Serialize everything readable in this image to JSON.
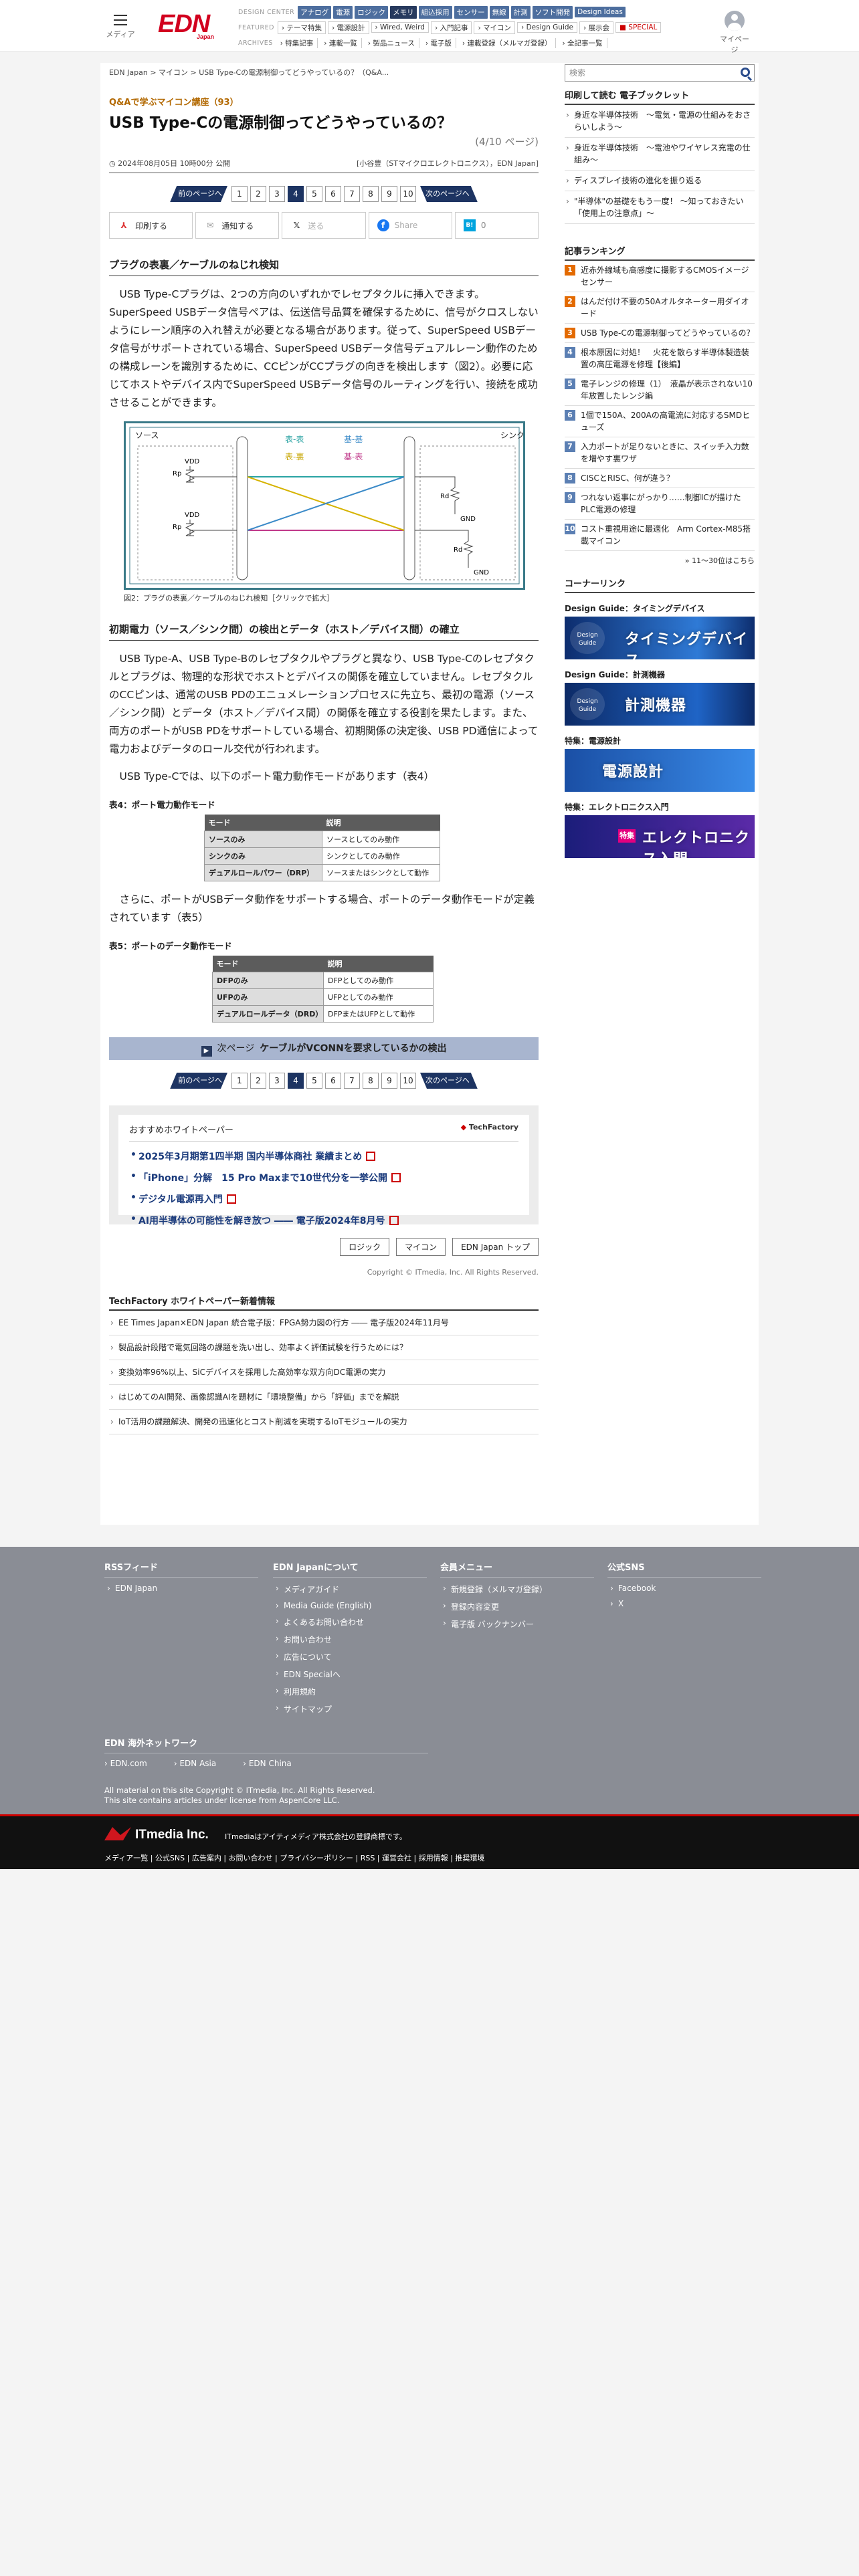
{
  "header": {
    "menu_label": "メディア",
    "logo": "EDN",
    "logo_sub": "Japan",
    "design_center_label": "DESIGN CENTER",
    "design_center_tabs": [
      "アナログ",
      "電源",
      "ロジック",
      "メモリ",
      "組込採用",
      "センサー",
      "無線",
      "計測",
      "ソフト開発",
      "Design Ideas"
    ],
    "featured_label": "FEATURED",
    "featured_items": [
      "テーマ特集",
      "電源設計",
      "Wired, Weird",
      "入門記事",
      "マイコン",
      "Design Guide",
      "展示会",
      "SPECIAL"
    ],
    "archives_label": "ARCHIVES",
    "archives_items": [
      "特集記事",
      "連載一覧",
      "製品ニュース",
      "電子版",
      "連載登録（メルマガ登録）",
      "全記事一覧"
    ],
    "mypage_label": "マイページ"
  },
  "article": {
    "breadcrumb": "EDN Japan > マイコン > USB Type-Cの電源制御ってどうやっているの？（Q&A...",
    "series": "Q&Aで学ぶマイコン講座（93）",
    "title": "USB Type-Cの電源制御ってどうやっているの？",
    "page_of": "(4/10 ページ)",
    "date": "2024年08月05日 10時00分 公開",
    "byline": "[小谷豊（STマイクロエレクトロニクス），EDN Japan]",
    "pager": {
      "prev": "前のページへ",
      "next": "次のページへ",
      "pages": [
        "1",
        "2",
        "3",
        "4",
        "5",
        "6",
        "7",
        "8",
        "9",
        "10"
      ],
      "current": "4"
    },
    "share": [
      "印刷する",
      "通知する",
      "送る",
      "Share",
      "B!"
    ],
    "share_extra": "0",
    "h_flip": "プラグの表裏／ケーブルのねじれ検知",
    "p1": "USB Type-Cプラグは、2つの方向のいずれかでレセプタクルに挿入できます。SuperSpeed USBデータ信号ペアは、伝送信号品質を確保するために、信号がクロスしないようにレーン順序の入れ替えが必要となる場合があります。従って、SuperSpeed USBデータ信号がサポートされている場合、SuperSpeed USBデータ信号デュアルレーン動作のための構成レーンを識別するために、CCピンがCCプラグの向きを検出します（図2）。必要に応じてホストやデバイス内でSuperSpeed USBデータ信号のルーティングを行い、接続を成功させることができます。",
    "fig": {
      "source": "ソース",
      "sink": "シンク",
      "l1": "表-表",
      "l2": "基-基",
      "l3": "表-裏",
      "l4": "基-表",
      "vdd": "VDD",
      "rp": "Rp",
      "rd": "Rd",
      "gnd": "GND",
      "caption": "図2：プラグの表裏／ケーブルのねじれ検知［クリックで拡大］"
    },
    "h_role": "初期電力（ソース／シンク間）の検出とデータ（ホスト／デバイス間）の確立",
    "p2": "USB Type-A、USB Type-Bのレセプタクルやプラグと異なり、USB Type-Cのレセプタクルとプラグは、物理的な形状でホストとデバイスの関係を確立していません。レセプタクルのCCピンは、通常のUSB PDのエニュメレーションプロセスに先立ち、最初の電源（ソース／シンク間）とデータ（ホスト／デバイス間）の関係を確立する役割を果たします。また、両方のポートがUSB PDをサポートしている場合、初期関係の決定後、USB PD通信によって電力およびデータのロール交代が行われます。",
    "p3": "USB Type-Cでは、以下のポート電力動作モードがあります（表4）",
    "t4_cap": "表4：ポート電力動作モード",
    "t4_head": [
      "モード",
      "説明"
    ],
    "t4_rows": [
      [
        "ソースのみ",
        "ソースとしてのみ動作"
      ],
      [
        "シンクのみ",
        "シンクとしてのみ動作"
      ],
      [
        "デュアルロールパワー（DRP）",
        "ソースまたはシンクとして動作"
      ]
    ],
    "p4": "さらに、ポートがUSBデータ動作をサポートする場合、ポートのデータ動作モードが定義されています（表5）",
    "t5_cap": "表5：ポートのデータ動作モード",
    "t5_head": [
      "モード",
      "説明"
    ],
    "t5_rows": [
      [
        "DFPのみ",
        "DFPとしてのみ動作"
      ],
      [
        "UFPのみ",
        "UFPとしてのみ動作"
      ],
      [
        "デュアルロールデータ（DRD）",
        "DFPまたはUFPとして動作"
      ]
    ],
    "next_page_label": "次ページ",
    "next_page_title": "ケーブルがVCONNを要求しているかの検出",
    "wp_title": "おすすめホワイトペーパー",
    "wp_brand": "TechFactory",
    "wp_items": [
      "2025年3月期第1四半期 国内半導体商社 業績まとめ",
      "「iPhone」分解　15 Pro Maxまで10世代分を一挙公開",
      "デジタル電源再入門",
      "AI用半導体の可能性を解き放つ ―― 電子版2024年8月号"
    ],
    "end_buttons": [
      "ロジック",
      "マイコン",
      "EDN Japan トップ"
    ],
    "copyright": "Copyright © ITmedia, Inc. All Rights Reserved.",
    "tf_head": "TechFactory ホワイトペーパー新着情報",
    "tf_items": [
      "EE Times Japan×EDN Japan 統合電子版：FPGA勢力図の行方 ―― 電子版2024年11月号",
      "製品設計段階で電気回路の課題を洗い出し、効率よく評価試験を行うためには？",
      "変換効率96%以上、SiCデバイスを採用した高効率な双方向DC電源の実力",
      "はじめてのAI開発、画像認識AIを題材に「環境整備」から「評価」までを解説",
      "IoT活用の課題解決、開発の迅速化とコスト削減を実現するIoTモジュールの実力"
    ]
  },
  "sidebar": {
    "search_placeholder": "検索",
    "booklet_head": "印刷して読む 電子ブックレット",
    "booklets": [
      "身近な半導体技術　～電気・電源の仕組みをおさらいしよう～",
      "身近な半導体技術　～電池やワイヤレス充電の仕組み～",
      "ディスプレイ技術の進化を振り返る",
      "\"半導体\"の基礎をもう一度！ ～知っておきたい「使用上の注意点」～"
    ],
    "rank_head": "記事ランキング",
    "ranking": [
      {
        "n": "1",
        "t": "近赤外線域も高感度に撮影するCMOSイメージセンサー"
      },
      {
        "n": "2",
        "t": "はんだ付け不要の50Aオルタネーター用ダイオード"
      },
      {
        "n": "3",
        "t": "USB Type-Cの電源制御ってどうやっているの？"
      },
      {
        "n": "4",
        "t": "根本原因に対処！　火花を散らす半導体製造装置の高圧電源を修理【後編】"
      },
      {
        "n": "5",
        "t": "電子レンジの修理（1）　液晶が表示されない10年放置したレンジ編"
      },
      {
        "n": "6",
        "t": "1個で150A、200Aの高電流に対応するSMDヒューズ"
      },
      {
        "n": "7",
        "t": "入力ポートが足りないときに、スイッチ入力数を増やす裏ワザ"
      },
      {
        "n": "8",
        "t": "CISCとRISC、何が違う？"
      },
      {
        "n": "9",
        "t": "つれない返事にがっかり……制御ICが描けたPLC電源の修理"
      },
      {
        "n": "10",
        "t": "コスト重視用途に最適化　Arm Cortex-M85搭載マイコン"
      }
    ],
    "more": "» 11〜30位はこちら",
    "corner_head": "コーナーリンク",
    "corners": [
      {
        "label": "Design Guide：タイミングデバイス",
        "banner": "タイミングデバイス",
        "badge": "Design Guide"
      },
      {
        "label": "Design Guide：計測機器",
        "banner": "計測機器",
        "badge": "Design Guide"
      },
      {
        "label": "特集：電源設計",
        "banner": "電源設計",
        "badge": ""
      },
      {
        "label": "特集：エレクトロニクス入門",
        "banner": "エレクトロニクス入門",
        "badge": "特集"
      }
    ]
  },
  "footer": {
    "cols": [
      {
        "head": "RSSフィード",
        "items": [
          "EDN Japan"
        ]
      },
      {
        "head": "EDN Japanについて",
        "items": [
          "メディアガイド",
          "Media Guide (English)",
          "よくあるお問い合わせ",
          "お問い合わせ",
          "広告について",
          "EDN Specialへ",
          "利用規約",
          "サイトマップ"
        ]
      },
      {
        "head": "会員メニュー",
        "items": [
          "新規登録（メルマガ登録）",
          "登録内容変更",
          "電子版 バックナンバー"
        ]
      },
      {
        "head": "公式SNS",
        "items": [
          "Facebook",
          "X"
        ]
      }
    ],
    "overseas_head": "EDN 海外ネットワーク",
    "overseas": [
      "EDN.com",
      "EDN Asia",
      "EDN China"
    ],
    "copy1": "All material on this site Copyright © ITmedia, Inc. All Rights Reserved.",
    "copy2": "This site contains articles under license from AspenCore LLC.",
    "itmedia": "ITmedia Inc.",
    "itmedia_tx": "ITmediaはアイティメディア株式会社の登録商標です。",
    "links": "メディア一覧 | 公式SNS | 広告案内 | お問い合わせ | プライバシーポリシー | RSS | 運営会社 | 採用情報 | 推奨環境"
  }
}
